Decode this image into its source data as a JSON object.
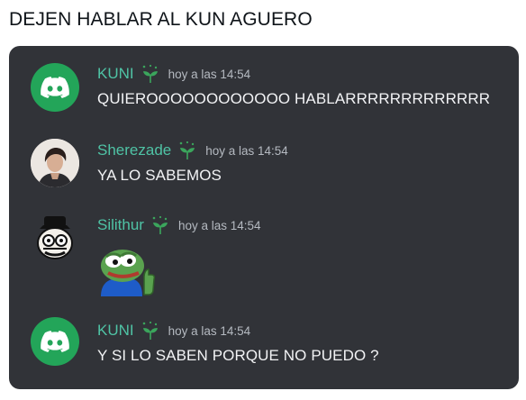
{
  "post": {
    "caption": "DEJEN HABLAR AL KUN AGUERO"
  },
  "colors": {
    "panel_bg": "#313338",
    "username": "#4fc3a5",
    "timestamp": "#b5bac1",
    "message_text": "#f2f3f5",
    "discord_avatar_bg": "#23a559",
    "badge_icon": "#3ba55c"
  },
  "messages": [
    {
      "username": "KUNI",
      "badge_icon": "sprout-icon",
      "avatar": "discord-logo-icon",
      "timestamp": "hoy a las 14:54",
      "text": "QUIEROOOOOOOOOOOO HABLARRRRRRRRRRRRR"
    },
    {
      "username": "Sherezade",
      "badge_icon": "sprout-icon",
      "avatar": "user-photo",
      "timestamp": "hoy a las 14:54",
      "text": "YA LO SABEMOS"
    },
    {
      "username": "Silithur",
      "badge_icon": "sprout-icon",
      "avatar": "meme-face-hat",
      "timestamp": "hoy a las 14:54",
      "sticker": "pepe-thumbs-up-sticker"
    },
    {
      "username": "KUNI",
      "badge_icon": "sprout-icon",
      "avatar": "discord-logo-icon",
      "timestamp": "hoy a las 14:54",
      "text": "Y SI LO SABEN PORQUE NO PUEDO ?"
    }
  ]
}
